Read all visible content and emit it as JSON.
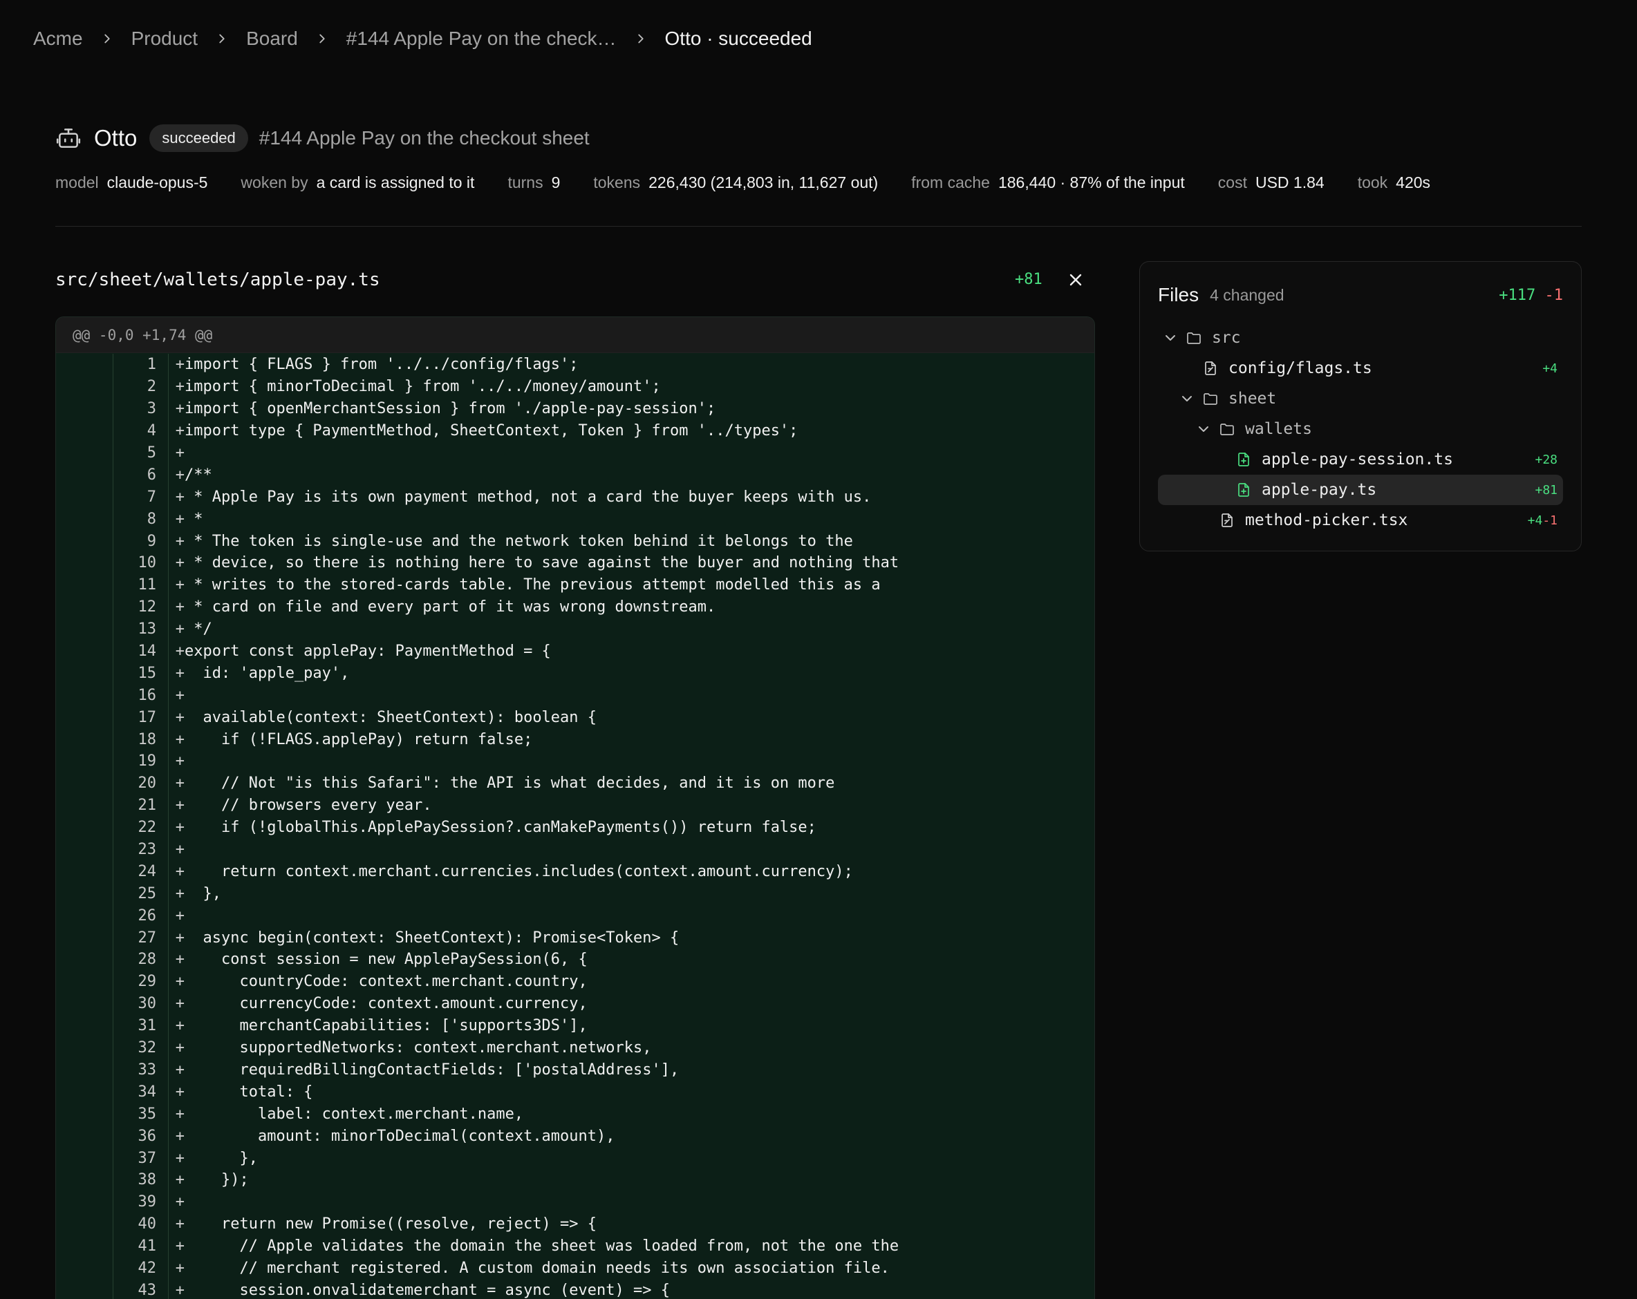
{
  "breadcrumb": {
    "items": [
      "Acme",
      "Product",
      "Board",
      "#144 Apple Pay on the check…"
    ],
    "current": "Otto · succeeded"
  },
  "run": {
    "agent": "Otto",
    "status": "succeeded",
    "card": "#144 Apple Pay on the checkout sheet",
    "meta": [
      {
        "label": "model",
        "value": "claude-opus-5"
      },
      {
        "label": "woken by",
        "value": "a card is assigned to it"
      },
      {
        "label": "turns",
        "value": "9"
      },
      {
        "label": "tokens",
        "value": "226,430 (214,803 in, 11,627 out)"
      },
      {
        "label": "from cache",
        "value": "186,440 · 87% of the input"
      },
      {
        "label": "cost",
        "value": "USD 1.84"
      },
      {
        "label": "took",
        "value": "420s"
      }
    ]
  },
  "file": {
    "path": "src/sheet/wallets/apple-pay.ts",
    "additions": "+81",
    "hunk": "@@ -0,0 +1,74 @@",
    "lines": [
      {
        "n": "1",
        "code": "import { FLAGS } from '../../config/flags';"
      },
      {
        "n": "2",
        "code": "import { minorToDecimal } from '../../money/amount';"
      },
      {
        "n": "3",
        "code": "import { openMerchantSession } from './apple-pay-session';"
      },
      {
        "n": "4",
        "code": "import type { PaymentMethod, SheetContext, Token } from '../types';"
      },
      {
        "n": "5",
        "code": ""
      },
      {
        "n": "6",
        "code": "/**"
      },
      {
        "n": "7",
        "code": " * Apple Pay is its own payment method, not a card the buyer keeps with us."
      },
      {
        "n": "8",
        "code": " *"
      },
      {
        "n": "9",
        "code": " * The token is single-use and the network token behind it belongs to the"
      },
      {
        "n": "10",
        "code": " * device, so there is nothing here to save against the buyer and nothing that"
      },
      {
        "n": "11",
        "code": " * writes to the stored-cards table. The previous attempt modelled this as a"
      },
      {
        "n": "12",
        "code": " * card on file and every part of it was wrong downstream."
      },
      {
        "n": "13",
        "code": " */"
      },
      {
        "n": "14",
        "code": "export const applePay: PaymentMethod = {"
      },
      {
        "n": "15",
        "code": "  id: 'apple_pay',"
      },
      {
        "n": "16",
        "code": ""
      },
      {
        "n": "17",
        "code": "  available(context: SheetContext): boolean {"
      },
      {
        "n": "18",
        "code": "    if (!FLAGS.applePay) return false;"
      },
      {
        "n": "19",
        "code": ""
      },
      {
        "n": "20",
        "code": "    // Not \"is this Safari\": the API is what decides, and it is on more"
      },
      {
        "n": "21",
        "code": "    // browsers every year."
      },
      {
        "n": "22",
        "code": "    if (!globalThis.ApplePaySession?.canMakePayments()) return false;"
      },
      {
        "n": "23",
        "code": ""
      },
      {
        "n": "24",
        "code": "    return context.merchant.currencies.includes(context.amount.currency);"
      },
      {
        "n": "25",
        "code": "  },"
      },
      {
        "n": "26",
        "code": ""
      },
      {
        "n": "27",
        "code": "  async begin(context: SheetContext): Promise<Token> {"
      },
      {
        "n": "28",
        "code": "    const session = new ApplePaySession(6, {"
      },
      {
        "n": "29",
        "code": "      countryCode: context.merchant.country,"
      },
      {
        "n": "30",
        "code": "      currencyCode: context.amount.currency,"
      },
      {
        "n": "31",
        "code": "      merchantCapabilities: ['supports3DS'],"
      },
      {
        "n": "32",
        "code": "      supportedNetworks: context.merchant.networks,"
      },
      {
        "n": "33",
        "code": "      requiredBillingContactFields: ['postalAddress'],"
      },
      {
        "n": "34",
        "code": "      total: {"
      },
      {
        "n": "35",
        "code": "        label: context.merchant.name,"
      },
      {
        "n": "36",
        "code": "        amount: minorToDecimal(context.amount),"
      },
      {
        "n": "37",
        "code": "      },"
      },
      {
        "n": "38",
        "code": "    });"
      },
      {
        "n": "39",
        "code": ""
      },
      {
        "n": "40",
        "code": "    return new Promise((resolve, reject) => {"
      },
      {
        "n": "41",
        "code": "      // Apple validates the domain the sheet was loaded from, not the one the"
      },
      {
        "n": "42",
        "code": "      // merchant registered. A custom domain needs its own association file."
      },
      {
        "n": "43",
        "code": "      session.onvalidatemerchant = async (event) => {"
      }
    ]
  },
  "files_panel": {
    "title": "Files",
    "count": "4 changed",
    "additions": "+117",
    "deletions": "-1",
    "tree": [
      {
        "name": "src",
        "type": "dir",
        "depth": 0,
        "add": "",
        "del": "",
        "selected": false,
        "icon": "folder-icon"
      },
      {
        "name": "config/flags.ts",
        "type": "file",
        "depth": 1,
        "add": "+4",
        "del": "",
        "selected": false,
        "icon": "file-diff-icon"
      },
      {
        "name": "sheet",
        "type": "dir",
        "depth": 1,
        "add": "",
        "del": "",
        "selected": false,
        "icon": "folder-icon"
      },
      {
        "name": "wallets",
        "type": "dir",
        "depth": 2,
        "add": "",
        "del": "",
        "selected": false,
        "icon": "folder-icon"
      },
      {
        "name": "apple-pay-session.ts",
        "type": "file",
        "depth": 3,
        "add": "+28",
        "del": "",
        "selected": false,
        "icon": "file-plus-icon"
      },
      {
        "name": "apple-pay.ts",
        "type": "file",
        "depth": 3,
        "add": "+81",
        "del": "",
        "selected": true,
        "icon": "file-plus-icon"
      },
      {
        "name": "method-picker.tsx",
        "type": "file",
        "depth": 2,
        "add": "+4",
        "del": "-1",
        "selected": false,
        "icon": "file-diff-icon"
      }
    ]
  },
  "colors": {
    "background": "#0a0a0a",
    "diff_added_bg": "#0c1f17",
    "addition": "#4ade80",
    "deletion": "#f87171"
  }
}
